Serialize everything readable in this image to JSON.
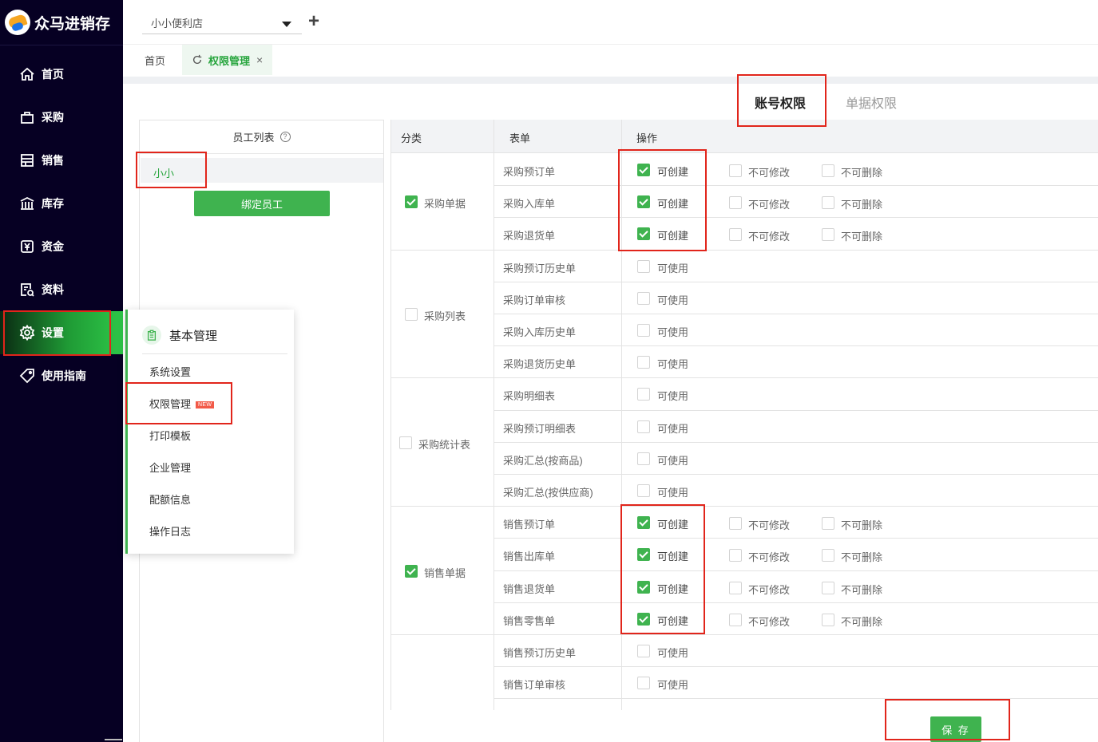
{
  "app": {
    "title": "众马进销存"
  },
  "sidebar": {
    "items": [
      {
        "label": "首页",
        "icon": "home-icon"
      },
      {
        "label": "采购",
        "icon": "shopping-bag-icon"
      },
      {
        "label": "销售",
        "icon": "store-icon"
      },
      {
        "label": "库存",
        "icon": "warehouse-icon"
      },
      {
        "label": "资金",
        "icon": "money-icon"
      },
      {
        "label": "资料",
        "icon": "document-search-icon"
      },
      {
        "label": "设置",
        "icon": "gear-icon",
        "active": true
      },
      {
        "label": "使用指南",
        "icon": "tag-icon"
      }
    ]
  },
  "header": {
    "store_select": "小小便利店",
    "add_label": "+"
  },
  "tabs": [
    {
      "label": "首页"
    },
    {
      "label": "权限管理",
      "active": true,
      "close": "×"
    }
  ],
  "permission_tabs": {
    "account": "账号权限",
    "document": "单据权限"
  },
  "employee_panel": {
    "title": "员工列表",
    "help": "?",
    "employees": [
      "小小"
    ],
    "bind_button": "绑定员工"
  },
  "settings_menu": {
    "title": "基本管理",
    "items": [
      "系统设置",
      "权限管理",
      "打印模板",
      "企业管理",
      "配额信息",
      "操作日志"
    ],
    "new_badge": "NEW"
  },
  "table": {
    "headers": {
      "category": "分类",
      "form": "表单",
      "operation": "操作"
    },
    "labels": {
      "create": "可创建",
      "no_edit": "不可修改",
      "no_delete": "不可删除",
      "use": "可使用"
    },
    "groups": [
      {
        "name": "采购单据",
        "checked": true,
        "rows": [
          "采购预订单",
          "采购入库单",
          "采购退货单"
        ],
        "type": "create"
      },
      {
        "name": "采购列表",
        "checked": false,
        "rows": [
          "采购预订历史单",
          "采购订单审核",
          "采购入库历史单",
          "采购退货历史单"
        ],
        "type": "use"
      },
      {
        "name": "采购统计表",
        "checked": false,
        "rows": [
          "采购明细表",
          "采购预订明细表",
          "采购汇总(按商品)",
          "采购汇总(按供应商)"
        ],
        "type": "use"
      },
      {
        "name": "销售单据",
        "checked": true,
        "rows": [
          "销售预订单",
          "销售出库单",
          "销售退货单",
          "销售零售单"
        ],
        "type": "create"
      },
      {
        "name": "",
        "checked": false,
        "rows": [
          "销售预订历史单",
          "销售订单审核"
        ],
        "type": "use"
      }
    ]
  },
  "save_button": "保 存"
}
